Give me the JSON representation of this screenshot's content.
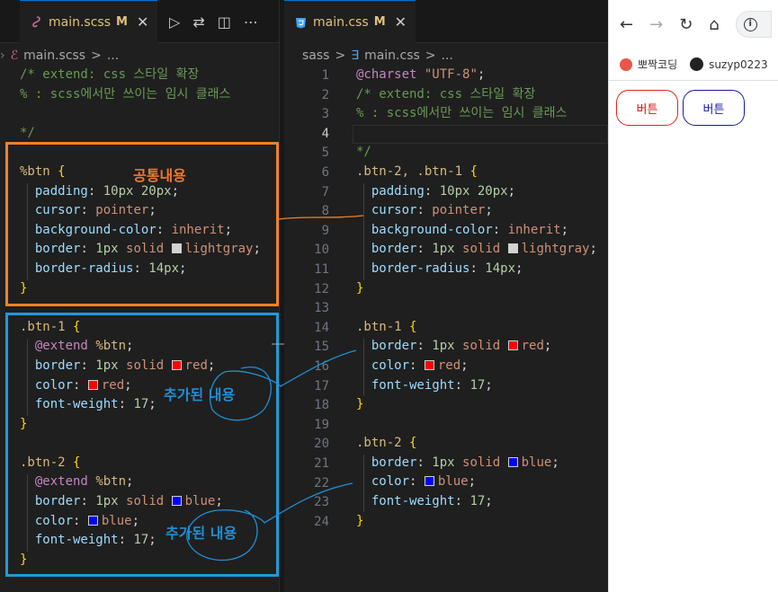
{
  "left_editor": {
    "tab": {
      "name": "main.scss",
      "modified": "M"
    },
    "breadcrumb": [
      "main.scss",
      ">",
      "..."
    ],
    "annotations": {
      "common": "공통내용",
      "added1": "추가된 내용",
      "added2": "추가된 내용"
    }
  },
  "right_editor": {
    "tab": {
      "name": "main.css",
      "modified": "M"
    },
    "breadcrumb": [
      "sass",
      ">",
      "main.css",
      ">",
      "..."
    ],
    "line_numbers": [
      "1",
      "2",
      "3",
      "4",
      "5",
      "6",
      "7",
      "8",
      "9",
      "10",
      "11",
      "12",
      "13",
      "14",
      "15",
      "16",
      "17",
      "18",
      "19",
      "20",
      "21",
      "22",
      "23",
      "24"
    ]
  },
  "colors": {
    "orange_box": "#f08228",
    "blue_box": "#1e9bd7",
    "annotation_text": "#1e8fd6",
    "common_text": "#f0782a"
  },
  "browser": {
    "bookmarks": [
      "뽀짝코딩",
      "suzyp0223"
    ],
    "omnibox_glyph": "i",
    "buttons": [
      {
        "label": "버튼",
        "border": "#e0261b",
        "color": "#d11"
      },
      {
        "label": "버튼",
        "border": "#1a1aa8",
        "color": "#1a1aa8"
      }
    ]
  }
}
